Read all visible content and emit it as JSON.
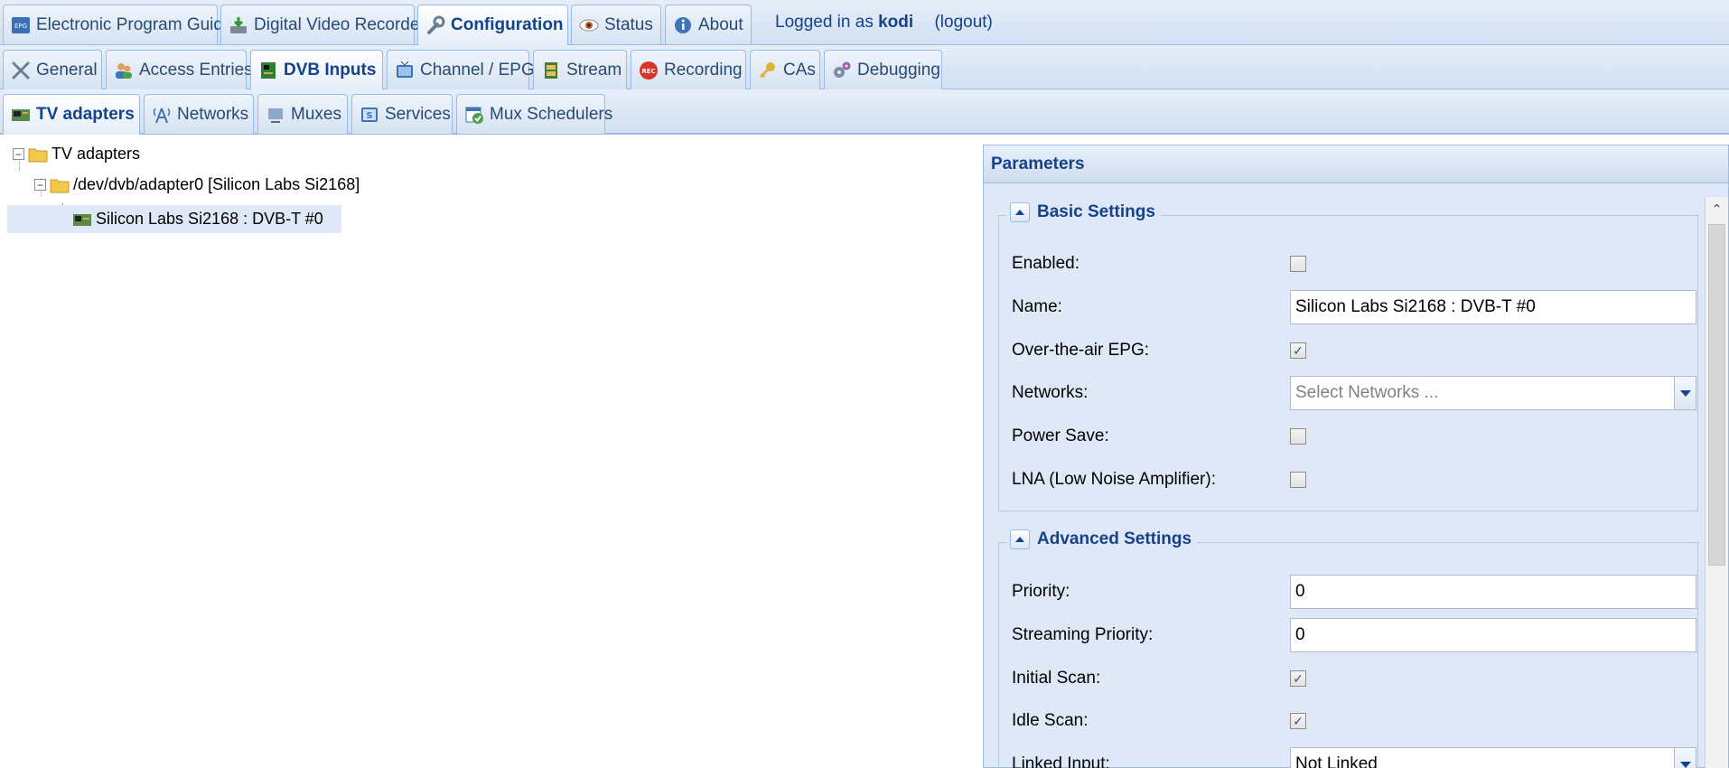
{
  "top_tabs": [
    {
      "label": "Electronic Program Guide",
      "icon": "epg-icon"
    },
    {
      "label": "Digital Video Recorder",
      "icon": "dvr-icon"
    },
    {
      "label": "Configuration",
      "icon": "wrench-icon"
    },
    {
      "label": "Status",
      "icon": "eye-icon"
    },
    {
      "label": "About",
      "icon": "info-icon"
    }
  ],
  "login": {
    "prefix": "Logged in as",
    "user": "kodi",
    "logout": "(logout)"
  },
  "config_tabs": [
    {
      "label": "General",
      "icon": "tools-icon"
    },
    {
      "label": "Access Entries",
      "icon": "users-icon"
    },
    {
      "label": "DVB Inputs",
      "icon": "card-icon"
    },
    {
      "label": "Channel / EPG",
      "icon": "tv-icon"
    },
    {
      "label": "Stream",
      "icon": "film-icon"
    },
    {
      "label": "Recording",
      "icon": "rec-icon"
    },
    {
      "label": "CAs",
      "icon": "key-icon"
    },
    {
      "label": "Debugging",
      "icon": "gears-icon"
    }
  ],
  "dvb_tabs": [
    {
      "label": "TV adapters",
      "icon": "adapter-icon"
    },
    {
      "label": "Networks",
      "icon": "antenna-icon"
    },
    {
      "label": "Muxes",
      "icon": "mux-icon"
    },
    {
      "label": "Services",
      "icon": "services-icon"
    },
    {
      "label": "Mux Schedulers",
      "icon": "scheduler-icon"
    }
  ],
  "tree": {
    "root": "TV adapters",
    "adapter": "/dev/dvb/adapter0 [Silicon Labs Si2168]",
    "frontend": "Silicon Labs Si2168 : DVB-T #0"
  },
  "panel": {
    "title": "Parameters",
    "basic": {
      "legend": "Basic Settings",
      "enabled": {
        "label": "Enabled:",
        "checked": false
      },
      "name": {
        "label": "Name:",
        "value": "Silicon Labs Si2168 : DVB-T #0"
      },
      "ota_epg": {
        "label": "Over-the-air EPG:",
        "checked": true
      },
      "networks": {
        "label": "Networks:",
        "placeholder": "Select Networks ..."
      },
      "power_save": {
        "label": "Power Save:",
        "checked": false
      },
      "lna": {
        "label": "LNA (Low Noise Amplifier):",
        "checked": false
      }
    },
    "advanced": {
      "legend": "Advanced Settings",
      "priority": {
        "label": "Priority:",
        "value": "0"
      },
      "streaming_priority": {
        "label": "Streaming Priority:",
        "value": "0"
      },
      "initial_scan": {
        "label": "Initial Scan:",
        "checked": true
      },
      "idle_scan": {
        "label": "Idle Scan:",
        "checked": true
      },
      "linked_input": {
        "label": "Linked Input:",
        "value": "Not Linked"
      }
    }
  },
  "check_mark": "✓",
  "tree_toggle": "−"
}
